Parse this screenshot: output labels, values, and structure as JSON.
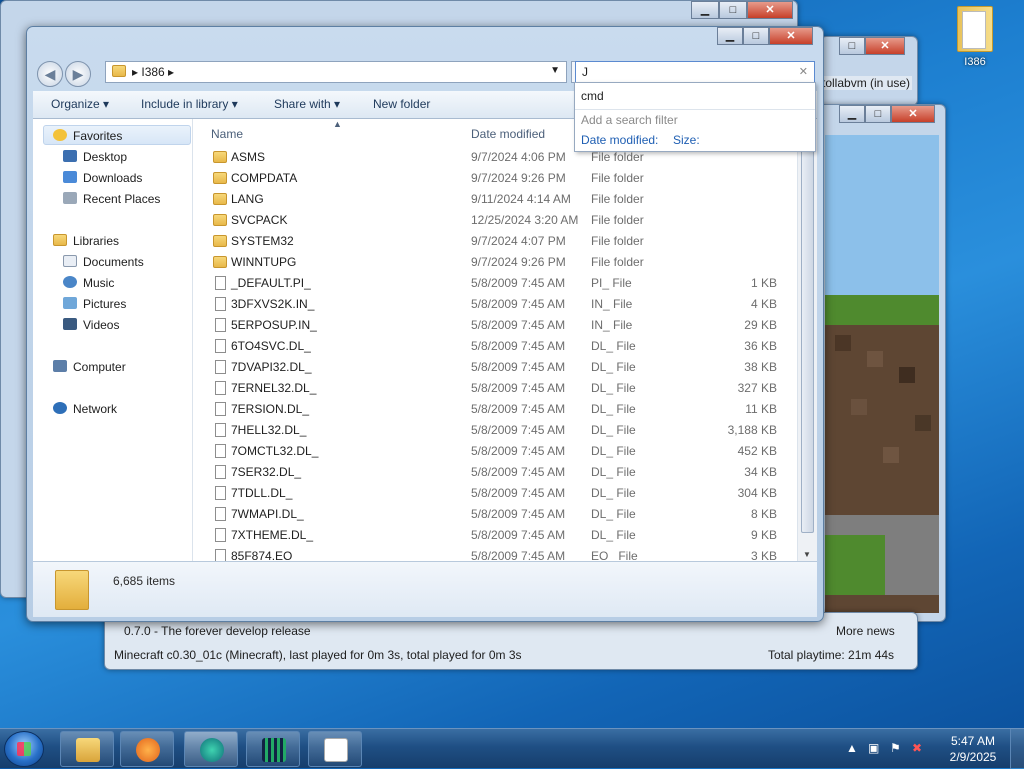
{
  "desktop_icon": {
    "label": "I386"
  },
  "explorer": {
    "address": {
      "crumb": "I386"
    },
    "search": {
      "value": "J"
    },
    "toolbar": {
      "organize": "Organize ▾",
      "include": "Include in library ▾",
      "share": "Share with ▾",
      "newfolder": "New folder"
    },
    "nav": {
      "favorites": "Favorites",
      "desktop": "Desktop",
      "downloads": "Downloads",
      "recent": "Recent Places",
      "libraries": "Libraries",
      "documents": "Documents",
      "music": "Music",
      "pictures": "Pictures",
      "videos": "Videos",
      "computer": "Computer",
      "network": "Network"
    },
    "columns": {
      "name": "Name",
      "date": "Date modified"
    },
    "rows": [
      {
        "name": "ASMS",
        "date": "9/7/2024 4:06 PM",
        "type": "File folder",
        "size": ""
      },
      {
        "name": "COMPDATA",
        "date": "9/7/2024 9:26 PM",
        "type": "File folder",
        "size": ""
      },
      {
        "name": "LANG",
        "date": "9/11/2024 4:14 AM",
        "type": "File folder",
        "size": ""
      },
      {
        "name": "SVCPACK",
        "date": "12/25/2024 3:20 AM",
        "type": "File folder",
        "size": ""
      },
      {
        "name": "SYSTEM32",
        "date": "9/7/2024 4:07 PM",
        "type": "File folder",
        "size": ""
      },
      {
        "name": "WINNTUPG",
        "date": "9/7/2024 9:26 PM",
        "type": "File folder",
        "size": ""
      },
      {
        "name": "_DEFAULT.PI_",
        "date": "5/8/2009 7:45 AM",
        "type": "PI_ File",
        "size": "1 KB"
      },
      {
        "name": "3DFXVS2K.IN_",
        "date": "5/8/2009 7:45 AM",
        "type": "IN_ File",
        "size": "4 KB"
      },
      {
        "name": "5ERPOSUP.IN_",
        "date": "5/8/2009 7:45 AM",
        "type": "IN_ File",
        "size": "29 KB"
      },
      {
        "name": "6TO4SVC.DL_",
        "date": "5/8/2009 7:45 AM",
        "type": "DL_ File",
        "size": "36 KB"
      },
      {
        "name": "7DVAPI32.DL_",
        "date": "5/8/2009 7:45 AM",
        "type": "DL_ File",
        "size": "38 KB"
      },
      {
        "name": "7ERNEL32.DL_",
        "date": "5/8/2009 7:45 AM",
        "type": "DL_ File",
        "size": "327 KB"
      },
      {
        "name": "7ERSION.DL_",
        "date": "5/8/2009 7:45 AM",
        "type": "DL_ File",
        "size": "11 KB"
      },
      {
        "name": "7HELL32.DL_",
        "date": "5/8/2009 7:45 AM",
        "type": "DL_ File",
        "size": "3,188 KB"
      },
      {
        "name": "7OMCTL32.DL_",
        "date": "5/8/2009 7:45 AM",
        "type": "DL_ File",
        "size": "452 KB"
      },
      {
        "name": "7SER32.DL_",
        "date": "5/8/2009 7:45 AM",
        "type": "DL_ File",
        "size": "34 KB"
      },
      {
        "name": "7TDLL.DL_",
        "date": "5/8/2009 7:45 AM",
        "type": "DL_ File",
        "size": "304 KB"
      },
      {
        "name": "7WMAPI.DL_",
        "date": "5/8/2009 7:45 AM",
        "type": "DL_ File",
        "size": "8 KB"
      },
      {
        "name": "7XTHEME.DL_",
        "date": "5/8/2009 7:45 AM",
        "type": "DL_ File",
        "size": "9 KB"
      },
      {
        "name": "85F874.EO_",
        "date": "5/8/2009 7:45 AM",
        "type": "EO_ File",
        "size": "3 KB"
      }
    ],
    "details": {
      "count": "6,685 items"
    }
  },
  "search_dropdown": {
    "suggestion": "cmd",
    "filter_hint": "Add a search filter",
    "filter_date": "Date modified:",
    "filter_size": "Size:"
  },
  "launcher": {
    "news": "0.7.0 - The forever develop release",
    "more_news": "More news",
    "status": "Minecraft c0.30_01c (Minecraft), last played for 0m 3s, total played for 0m 3s",
    "playtime": "Total playtime: 21m 44s",
    "account": "tollabvm (in use)"
  },
  "taskbar": {
    "clock_time": "5:47 AM",
    "clock_date": "2/9/2025"
  }
}
